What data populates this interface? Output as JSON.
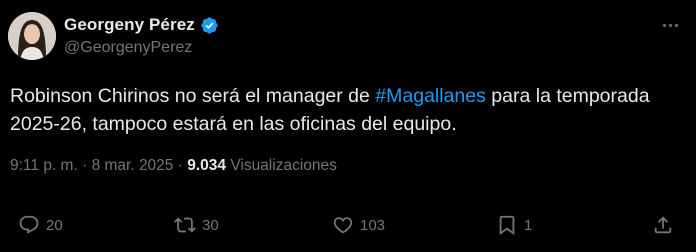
{
  "author": {
    "display_name": "Georgeny Pérez",
    "handle": "@GeorgenyPerez",
    "verified": true
  },
  "tweet": {
    "text_before": "Robinson Chirinos no será el manager de ",
    "hashtag": "#Magallanes",
    "text_after": " para la temporada 2025-26, tampoco estará en las oficinas del equipo."
  },
  "meta": {
    "time": "9:11 p. m.",
    "separator": " · ",
    "date": "8 mar. 2025",
    "views_count": "9.034",
    "views_label": "Visualizaciones"
  },
  "actions": {
    "replies": "20",
    "reposts": "30",
    "likes": "103",
    "bookmarks": "1"
  },
  "icons": {
    "more": "more-horizontal-icon",
    "verified": "verified-badge-icon",
    "reply": "reply-icon",
    "repost": "repost-icon",
    "like": "heart-icon",
    "bookmark": "bookmark-icon",
    "share": "share-icon"
  },
  "colors": {
    "background": "#000000",
    "text": "#e7e9ea",
    "secondary": "#71767b",
    "accent": "#1d9bf0"
  }
}
